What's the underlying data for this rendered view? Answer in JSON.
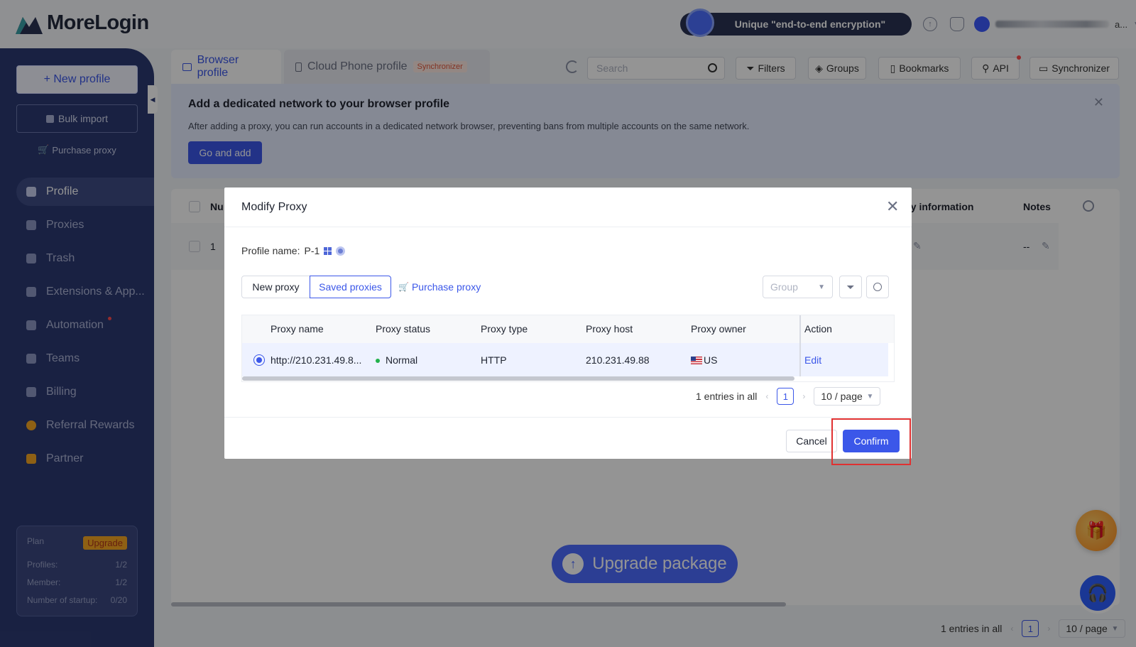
{
  "app": {
    "logo_text": "MoreLogin",
    "promo": "Unique \"end-to-end encryption\"",
    "user_suffix": "a..."
  },
  "sidebar": {
    "new_profile": "+ New profile",
    "bulk_import": "Bulk import",
    "purchase_proxy": "Purchase proxy",
    "items": [
      {
        "label": "Profile",
        "icon": "profile-icon",
        "active": true
      },
      {
        "label": "Proxies",
        "icon": "proxies-icon"
      },
      {
        "label": "Trash",
        "icon": "trash-icon"
      },
      {
        "label": "Extensions & App...",
        "icon": "extensions-icon"
      },
      {
        "label": "Automation",
        "icon": "automation-icon",
        "dot": true
      },
      {
        "label": "Teams",
        "icon": "teams-icon"
      },
      {
        "label": "Billing",
        "icon": "billing-icon"
      },
      {
        "label": "Referral Rewards",
        "icon": "referral-icon"
      },
      {
        "label": "Partner",
        "icon": "partner-icon"
      }
    ],
    "plan": {
      "label": "Plan",
      "upgrade": "Upgrade",
      "profiles_label": "Profiles:",
      "profiles_value": "1/2",
      "member_label": "Member:",
      "member_value": "1/2",
      "startup_label": "Number of startup:",
      "startup_value": "0/20"
    }
  },
  "tabs": {
    "browser_profile": "Browser profile",
    "cloud_phone_profile": "Cloud Phone profile",
    "synchronizer_badge": "Synchronizer"
  },
  "toolbar": {
    "search_placeholder": "Search",
    "filters": "Filters",
    "groups": "Groups",
    "bookmarks": "Bookmarks",
    "api": "API",
    "synchronizer": "Synchronizer"
  },
  "banner": {
    "title": "Add a dedicated network to your browser profile",
    "text": "After adding a proxy, you can run accounts in a dedicated network browser, preventing bans from multiple accounts on the same network.",
    "button": "Go and add"
  },
  "background_table": {
    "col_num": "Nu",
    "col_proxy_info": "xy information",
    "col_notes": "Notes",
    "row_num": "1",
    "row_notes": "--"
  },
  "upgrade_package": "Upgrade package",
  "footer": {
    "entries": "1 entries in all",
    "page": "1",
    "per_page": "10 / page"
  },
  "modal": {
    "title": "Modify Proxy",
    "profile_label": "Profile name:",
    "profile_value": "P-1",
    "seg_new": "New proxy",
    "seg_saved": "Saved proxies",
    "purchase_link": "Purchase proxy",
    "group_placeholder": "Group",
    "columns": [
      "Proxy name",
      "Proxy status",
      "Proxy type",
      "Proxy host",
      "Proxy owner",
      "Action"
    ],
    "row": {
      "name": "http://210.231.49.8...",
      "status": "Normal",
      "type": "HTTP",
      "host": "210.231.49.88",
      "owner": "US",
      "action": "Edit"
    },
    "pagination": {
      "entries": "1 entries in all",
      "page": "1",
      "per_page": "10 / page"
    },
    "cancel": "Cancel",
    "confirm": "Confirm"
  },
  "colors": {
    "primary": "#3b57e9",
    "sidebar": "#2c3a73",
    "status_normal": "#22b14c",
    "highlight": "#e03131"
  }
}
